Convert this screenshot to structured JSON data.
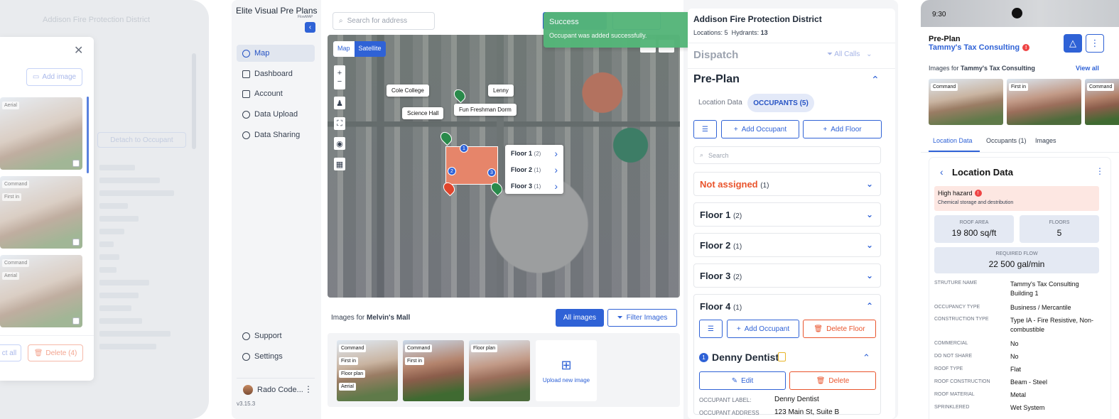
{
  "left_panel": {
    "ghost_title": "Addison Fire Protection District",
    "add_image_label": "Add image",
    "select_all_label": "ct all",
    "delete_label": "Delete (4)",
    "thumb_tags": [
      [
        "Aerial"
      ],
      [
        "Command",
        "First in"
      ],
      [
        "Command",
        "Aerial"
      ]
    ],
    "ghost_link": "Detach to Occupant"
  },
  "app": {
    "brand": "Elite Visual Pre Plans",
    "brand_sub": "FlowMAP",
    "nav": [
      {
        "label": "Map",
        "icon": "compass-icon",
        "active": true
      },
      {
        "label": "Dashboard",
        "icon": "dashboard-icon"
      },
      {
        "label": "Account",
        "icon": "account-icon"
      },
      {
        "label": "Data Upload",
        "icon": "cloud-upload-icon"
      },
      {
        "label": "Data Sharing",
        "icon": "share-icon"
      }
    ],
    "support_label": "Support",
    "settings_label": "Settings",
    "user_name": "Rado Code...",
    "version": "v3.15.3",
    "search_placeholder": "Search for address",
    "toast": {
      "title": "Success",
      "message": "Occupant was added successfully."
    },
    "map": {
      "toggle": [
        "Map",
        "Satellite"
      ],
      "labels": [
        "Cole College",
        "Lenny",
        "Science Hall",
        "Fun Freshman Dorm"
      ],
      "pins": [
        "1",
        "2",
        "3"
      ],
      "floors": [
        {
          "name": "Floor 1",
          "count": "(2)"
        },
        {
          "name": "Floor 2",
          "count": "(1)"
        },
        {
          "name": "Floor 3",
          "count": "(1)"
        }
      ]
    },
    "images_for_prefix": "Images for",
    "images_for_name": "Melvin's Mall",
    "all_images_label": "All images",
    "filter_images_label": "Filter Images",
    "thumbs": [
      {
        "tags": [
          "Command",
          "First in",
          "Floor plan",
          "Aerial"
        ]
      },
      {
        "tags": [
          "Command",
          "First in"
        ]
      },
      {
        "tags": [
          "Floor plan"
        ]
      }
    ],
    "upload_label": "Upload new image",
    "district": {
      "name": "Addison Fire Protection District",
      "locations_label": "Locations:",
      "locations_value": "5",
      "hydrants_label": "Hydrants:",
      "hydrants_value": "13"
    },
    "dispatch_label": "Dispatch",
    "all_calls_label": "All Calls",
    "preplan_label": "Pre-Plan",
    "tabs": [
      "Location Data",
      "OCCUPANTS (5)"
    ],
    "add_occupant_label": "Add Occupant",
    "add_floor_label": "Add Floor",
    "search_label": "Search",
    "groups": [
      {
        "name": "Not assigned",
        "count": "(1)"
      },
      {
        "name": "Floor 1",
        "count": "(2)"
      },
      {
        "name": "Floor 2",
        "count": "(1)"
      },
      {
        "name": "Floor 3",
        "count": "(2)"
      },
      {
        "name": "Floor 4",
        "count": "(1)"
      }
    ],
    "delete_floor_label": "Delete Floor",
    "occupant": {
      "index": "1",
      "name": "Denny Dentist",
      "edit_label": "Edit",
      "delete_label": "Delete",
      "fields": [
        {
          "k": "OCCUPANT LABEL:",
          "v": "Denny Dentist"
        },
        {
          "k": "OCCUPANT ADDRESS",
          "v": "123 Main St, Suite B"
        }
      ]
    }
  },
  "phone": {
    "time": "9:30",
    "title": "Pre-Plan",
    "subtitle": "Tammy's Tax Consulting",
    "images_for_prefix": "Images for",
    "images_for_name": "Tammy's Tax Consulting",
    "view_all_label": "View all",
    "thumbs": [
      {
        "tag": "Command"
      },
      {
        "tag": "First in"
      },
      {
        "tag": "Command"
      }
    ],
    "tabs": [
      "Location Data",
      "Occupants (1)",
      "Images"
    ],
    "card_title": "Location Data",
    "hazard_title": "High hazard",
    "hazard_text": "Chemical storage and destribution",
    "roof_area_label": "ROOF AREA",
    "roof_area_value": "19 800 sq/ft",
    "floors_label": "FLOORS",
    "floors_value": "5",
    "flow_label": "REQUIRED FLOW",
    "flow_value": "22 500 gal/min",
    "fields": [
      {
        "k": "STRUTURE NAME",
        "v": "Tammy's Tax Consulting Building 1"
      },
      {
        "k": "OCCUPANCY TYPE",
        "v": "Business / Mercantile"
      },
      {
        "k": "CONSTRUCTION TYPE",
        "v": "Type IA - Fire Resistive, Non-combustible"
      },
      {
        "k": "COMMERCIAL",
        "v": "No"
      },
      {
        "k": "DO NOT SHARE",
        "v": "No"
      },
      {
        "k": "ROOF TYPE",
        "v": "Flat"
      },
      {
        "k": "ROOF CONSTRUCTION",
        "v": "Beam - Steel"
      },
      {
        "k": "ROOF MATERIAL",
        "v": "Metal"
      },
      {
        "k": "SPRINKLERED",
        "v": "Wet System"
      }
    ],
    "colors": {
      "accent": "#2f62d6",
      "danger": "#ef4444",
      "hazard_bg": "#fde7e2"
    }
  }
}
